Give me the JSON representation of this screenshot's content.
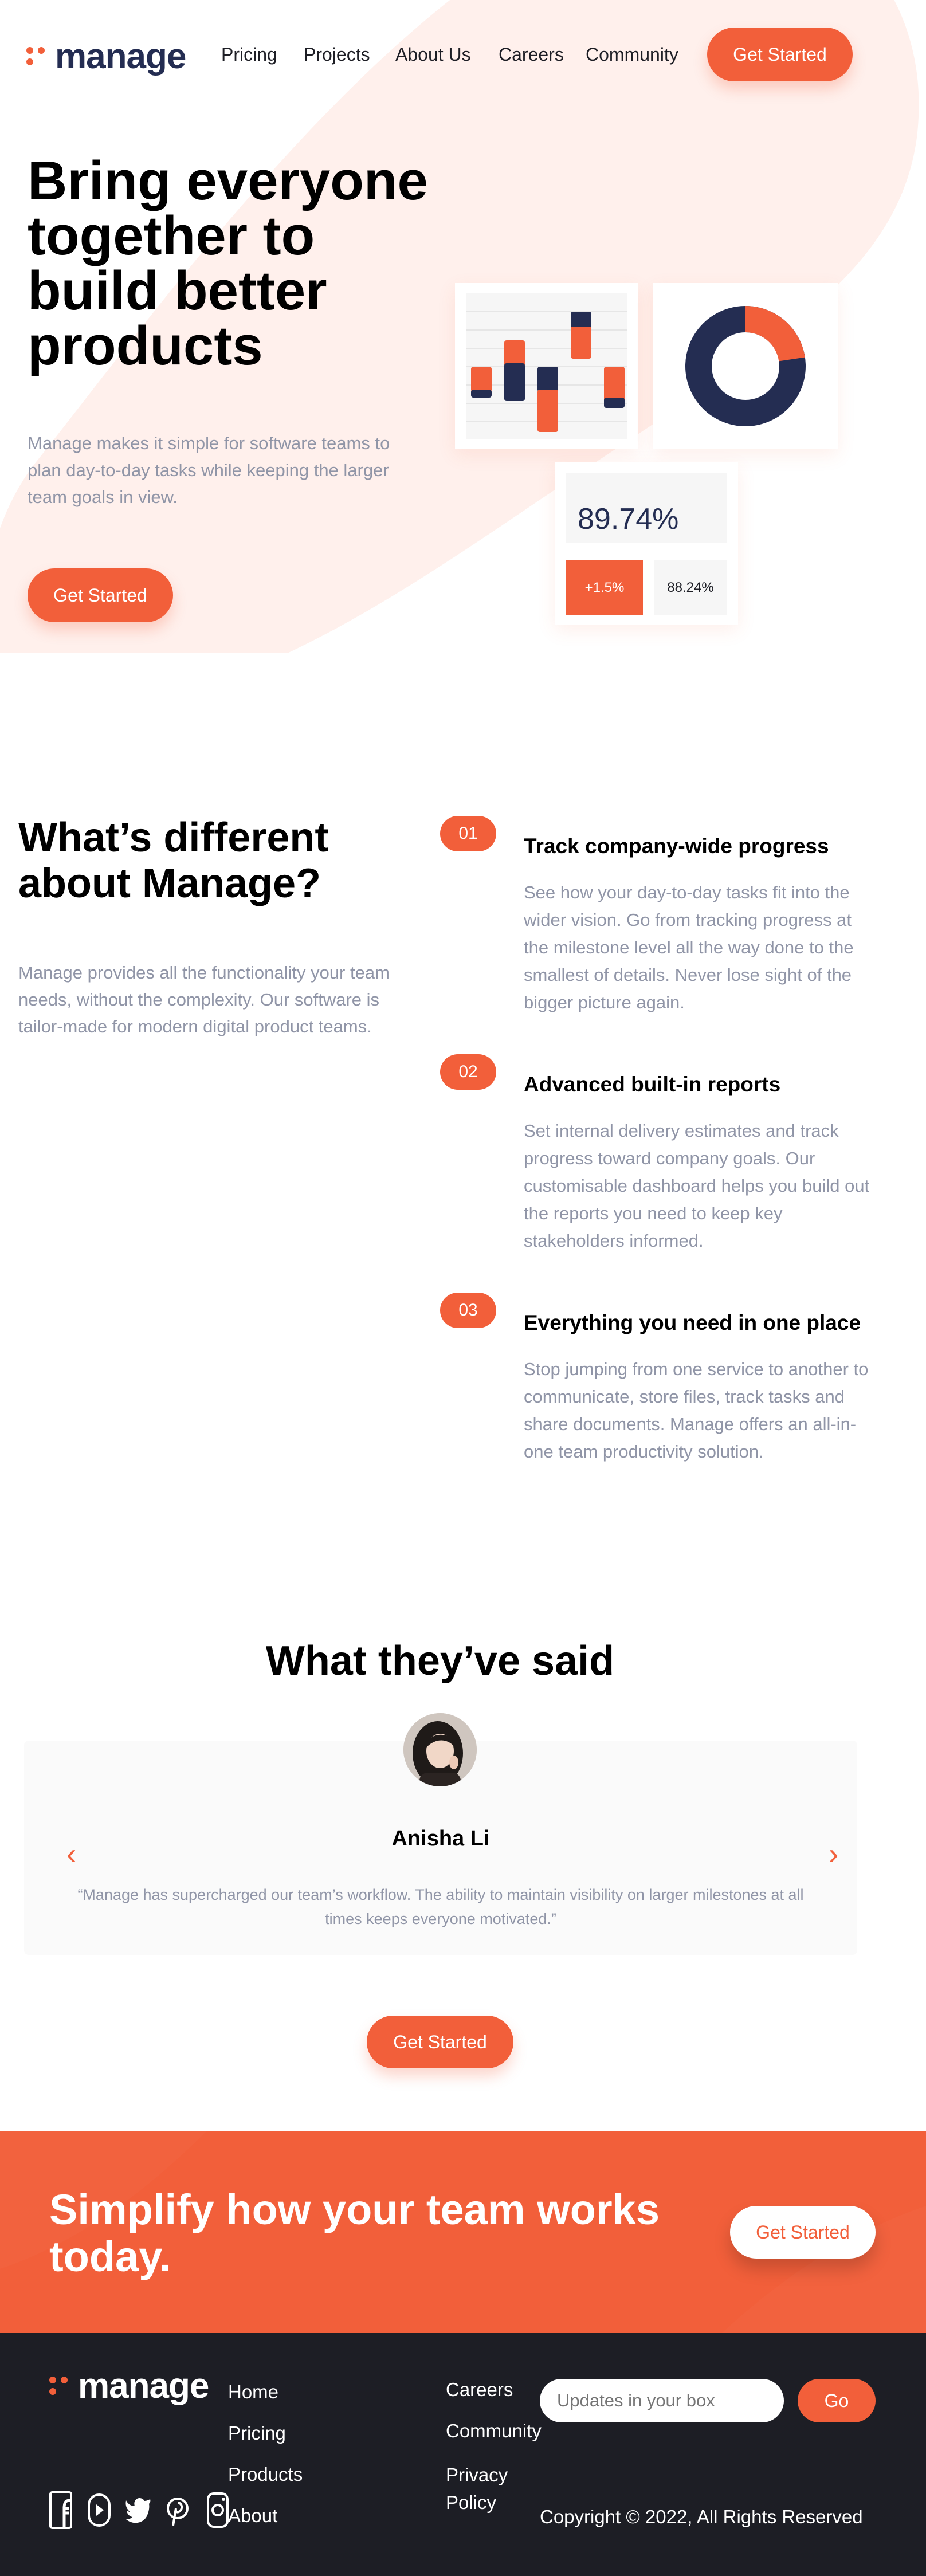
{
  "brand": {
    "name": "manage",
    "accent": "#f25f3a",
    "dark": "#242d52",
    "footer_bg": "#1d1e25"
  },
  "nav": {
    "items": [
      "Pricing",
      "Projects",
      "About Us",
      "Careers",
      "Community"
    ],
    "cta": "Get Started"
  },
  "hero": {
    "title": "Bring everyone together to build better products",
    "description": "Manage makes it simple for software teams to plan day-to-day tasks while keeping the larger team goals in view.",
    "cta": "Get Started",
    "dashboard": {
      "stat_value": "89.74%",
      "chip_up": "+1.5%",
      "chip_value": "88.24%",
      "donut_fraction": 0.92
    }
  },
  "different": {
    "title": "What’s different about Manage?",
    "description": "Manage provides all the functionality your team needs, without the complexity. Our software is tailor-made for modern digital product teams.",
    "features": [
      {
        "num": "01",
        "title": "Track company-wide progress",
        "text": "See how your day-to-day tasks fit into the wider vision. Go from tracking progress at the milestone level all the way done to the smallest of details. Never lose sight of the bigger picture again."
      },
      {
        "num": "02",
        "title": "Advanced built-in reports",
        "text": "Set internal delivery estimates and track progress toward company goals. Our customisable dashboard helps you build out the reports you need to keep key stakeholders informed."
      },
      {
        "num": "03",
        "title": "Everything you need in one place",
        "text": "Stop jumping from one service to another to communicate, store files, track tasks and share documents. Manage offers an all-in-one team productivity solution."
      }
    ]
  },
  "testimonials": {
    "title": "What they’ve said",
    "name": "Anisha Li",
    "quote": "“Manage has supercharged our team’s workflow. The ability to maintain visibility on larger milestones at all times keeps everyone motivated.”",
    "prev_icon": "chevron-left-icon",
    "next_icon": "chevron-right-icon",
    "cta": "Get Started"
  },
  "cta_band": {
    "title": "Simplify how your team works today.",
    "cta": "Get Started"
  },
  "footer": {
    "col1": [
      "Home",
      "Pricing",
      "Products",
      "About"
    ],
    "col2": [
      "Careers",
      "Community",
      "Privacy Policy"
    ],
    "newsletter_placeholder": "Updates in your box",
    "go": "Go",
    "copyright": "Copyright © 2022, All Rights Reserved",
    "social_icons": [
      "facebook-icon",
      "youtube-icon",
      "twitter-icon",
      "pinterest-icon",
      "instagram-icon"
    ]
  }
}
